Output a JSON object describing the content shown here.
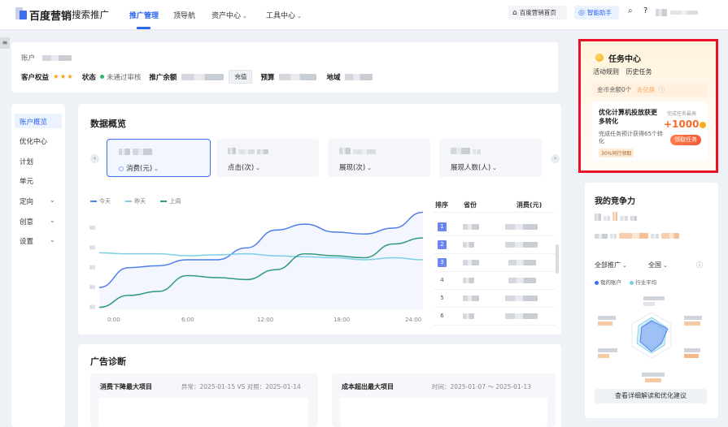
{
  "header": {
    "brand": "百度营销",
    "product": "搜索推广",
    "nav": [
      "推广管理",
      "顶导航",
      "资产中心",
      "工具中心"
    ],
    "home_btn": "百度营销首页",
    "helper_btn": "智能助手"
  },
  "account": {
    "label_account": "账户",
    "label_rights": "客户权益",
    "stars": "★★★",
    "label_status": "状态",
    "status_value": "未通过审核",
    "label_balance": "推广余额",
    "recharge": "充值",
    "label_budget": "预算",
    "label_region": "地域"
  },
  "task": {
    "title": "任务中心",
    "links": [
      "活动规则",
      "历史任务"
    ],
    "gold_text": "金币余额0个",
    "exchange": "去兑换",
    "card_title": "优化计算机投放获更多转化",
    "card_desc": "完成任务预计获得65个转化",
    "card_tag": "30%同行领取",
    "reward_caption": "完成任务最高",
    "reward": "+1000",
    "claim_btn": "领取任务"
  },
  "sidenav": {
    "items": [
      "账户概览",
      "优化中心",
      "计划",
      "单元",
      "定向",
      "创意",
      "设置"
    ]
  },
  "overview": {
    "title": "数据概览",
    "metrics": [
      "消费(元)",
      "点击(次)",
      "展现(次)",
      "展现人数(人)"
    ],
    "legend": [
      "今天",
      "昨天",
      "上周"
    ],
    "rank_headers": [
      "排序",
      "省份",
      "消费(元)"
    ],
    "ranks": [
      "1",
      "2",
      "3",
      "4",
      "5",
      "6"
    ]
  },
  "chart_data": {
    "type": "line",
    "x": [
      "0:00",
      "6:00",
      "12:00",
      "18:00",
      "24:00"
    ],
    "series": [
      {
        "name": "今天",
        "color": "#4f7fe8",
        "values": [
          0.22,
          0.42,
          0.44,
          0.5,
          0.5,
          0.62,
          0.8,
          0.86,
          0.78,
          0.76,
          0.82,
          0.98
        ]
      },
      {
        "name": "昨天",
        "color": "#7cd0e6",
        "values": [
          0.57,
          0.56,
          0.56,
          0.54,
          0.55,
          0.56,
          0.54,
          0.53,
          0.52,
          0.5,
          0.52,
          0.5
        ]
      },
      {
        "name": "上周",
        "color": "#2f9a7c",
        "values": [
          0.02,
          0.14,
          0.18,
          0.34,
          0.32,
          0.3,
          0.4,
          0.56,
          0.54,
          0.52,
          0.66,
          0.72
        ]
      }
    ]
  },
  "competition": {
    "title": "我的竞争力",
    "filter_scope": "全部推广",
    "filter_region": "全国",
    "legend_mine": "我的账户",
    "legend_avg": "行业平均",
    "detail_btn": "查看详细解读和优化建议"
  },
  "diagnosis": {
    "title": "广告诊断",
    "box1_title": "消费下降最大项目",
    "box1_meta": "异常：2025-01-15 VS 对照：2025-01-14",
    "box2_title": "成本超出最大项目",
    "box2_meta": "时间：2025-01-07 ～ 2025-01-13"
  }
}
